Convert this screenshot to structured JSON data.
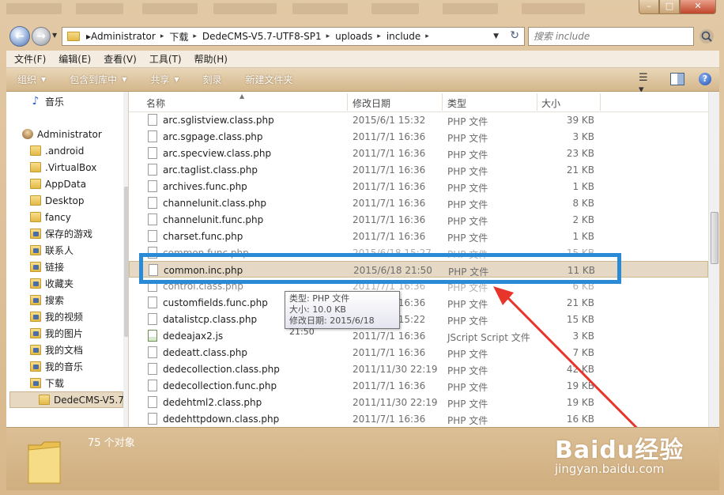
{
  "address": {
    "crumbs": [
      "Administrator",
      "下载",
      "DedeCMS-V5.7-UTF8-SP1",
      "uploads",
      "include"
    ],
    "search_placeholder": "搜索 include"
  },
  "menu": [
    "文件(F)",
    "编辑(E)",
    "查看(V)",
    "工具(T)",
    "帮助(H)"
  ],
  "toolbar": {
    "organize": "组织",
    "include_in_library": "包含到库中",
    "share": "共享",
    "burn": "刻录",
    "new_folder": "新建文件夹"
  },
  "nav": [
    {
      "label": "音乐",
      "icon": "music-icon"
    },
    {
      "label": "Administrator",
      "icon": "user-icon"
    },
    {
      "label": ".android",
      "icon": "folder-icon"
    },
    {
      "label": ".VirtualBox",
      "icon": "folder-icon"
    },
    {
      "label": "AppData",
      "icon": "folder-icon"
    },
    {
      "label": "Desktop",
      "icon": "folder-icon"
    },
    {
      "label": "fancy",
      "icon": "folder-icon"
    },
    {
      "label": "保存的游戏",
      "icon": "saved-games-icon"
    },
    {
      "label": "联系人",
      "icon": "contacts-icon"
    },
    {
      "label": "链接",
      "icon": "links-icon"
    },
    {
      "label": "收藏夹",
      "icon": "favorites-icon"
    },
    {
      "label": "搜索",
      "icon": "searches-icon"
    },
    {
      "label": "我的视频",
      "icon": "videos-icon"
    },
    {
      "label": "我的图片",
      "icon": "pictures-icon"
    },
    {
      "label": "我的文档",
      "icon": "documents-icon"
    },
    {
      "label": "我的音乐",
      "icon": "music-folder-icon"
    },
    {
      "label": "下载",
      "icon": "downloads-icon"
    },
    {
      "label": "DedeCMS-V5.7",
      "icon": "folder-icon"
    }
  ],
  "columns": {
    "name": "名称",
    "date": "修改日期",
    "type": "类型",
    "size": "大小"
  },
  "files": [
    {
      "name": "arc.sglistview.class.php",
      "date": "2015/6/1 15:32",
      "type": "PHP 文件",
      "size": "39 KB"
    },
    {
      "name": "arc.sgpage.class.php",
      "date": "2011/7/1 16:36",
      "type": "PHP 文件",
      "size": "3 KB"
    },
    {
      "name": "arc.specview.class.php",
      "date": "2011/7/1 16:36",
      "type": "PHP 文件",
      "size": "23 KB"
    },
    {
      "name": "arc.taglist.class.php",
      "date": "2011/7/1 16:36",
      "type": "PHP 文件",
      "size": "21 KB"
    },
    {
      "name": "archives.func.php",
      "date": "2011/7/1 16:36",
      "type": "PHP 文件",
      "size": "1 KB"
    },
    {
      "name": "channelunit.class.php",
      "date": "2011/7/1 16:36",
      "type": "PHP 文件",
      "size": "8 KB"
    },
    {
      "name": "channelunit.func.php",
      "date": "2011/7/1 16:36",
      "type": "PHP 文件",
      "size": "2 KB"
    },
    {
      "name": "charset.func.php",
      "date": "2011/7/1 16:36",
      "type": "PHP 文件",
      "size": "1 KB"
    },
    {
      "name": "common.func.php",
      "date": "2015/6/18 15:27",
      "type": "PHP 文件",
      "size": "15 KB"
    },
    {
      "name": "common.inc.php",
      "date": "2015/6/18 21:50",
      "type": "PHP 文件",
      "size": "11 KB"
    },
    {
      "name": "control.class.php",
      "date": "2011/7/1 16:36",
      "type": "PHP 文件",
      "size": "6 KB"
    },
    {
      "name": "customfields.func.php",
      "date": "2011/7/1 16:36",
      "type": "PHP 文件",
      "size": "21 KB"
    },
    {
      "name": "datalistcp.class.php",
      "date": "2015/6/1 15:22",
      "type": "PHP 文件",
      "size": "15 KB"
    },
    {
      "name": "dedeajax2.js",
      "date": "2011/7/1 16:36",
      "type": "JScript Script 文件",
      "size": "3 KB"
    },
    {
      "name": "dedeatt.class.php",
      "date": "2011/7/1 16:36",
      "type": "PHP 文件",
      "size": "7 KB"
    },
    {
      "name": "dedecollection.class.php",
      "date": "2011/11/30 22:19",
      "type": "PHP 文件",
      "size": "42 KB"
    },
    {
      "name": "dedecollection.func.php",
      "date": "2011/7/1 16:36",
      "type": "PHP 文件",
      "size": "19 KB"
    },
    {
      "name": "dedehtml2.class.php",
      "date": "2011/11/30 22:19",
      "type": "PHP 文件",
      "size": "19 KB"
    },
    {
      "name": "dedehttpdown.class.php",
      "date": "2011/7/1 16:36",
      "type": "PHP 文件",
      "size": "16 KB"
    }
  ],
  "tooltip": {
    "type": "类型: PHP 文件",
    "size": "大小: 10.0 KB",
    "date": "修改日期: 2015/6/18 21:50"
  },
  "status": {
    "count": "75 个对象"
  },
  "watermark": {
    "logo": "Baidu经验",
    "site": "jingyan.baidu.com"
  },
  "colors": {
    "highlight": "#2a8ad6",
    "arrow": "#e8352b",
    "chrome": "#d8b88c"
  }
}
